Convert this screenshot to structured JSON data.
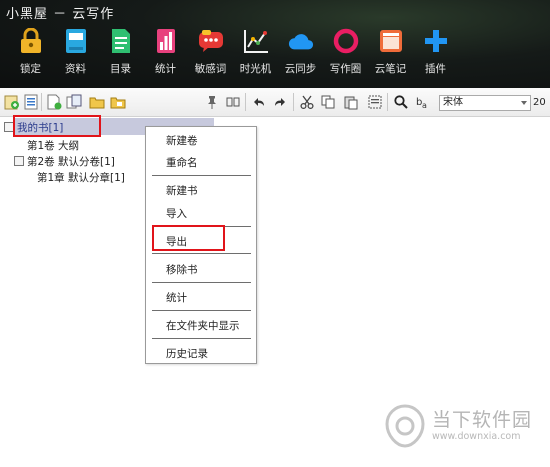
{
  "app": {
    "title": "小黑屋 － 云写作"
  },
  "toolbar": {
    "items": [
      {
        "label": "锁定",
        "icon": "lock-icon",
        "color": "#f0b429"
      },
      {
        "label": "资料",
        "icon": "book-icon",
        "color": "#29a8e0"
      },
      {
        "label": "目录",
        "icon": "document-icon",
        "color": "#2fbf71"
      },
      {
        "label": "统计",
        "icon": "bar-chart-icon",
        "color": "#e8417d"
      },
      {
        "label": "敏感词",
        "icon": "speech-bubble-icon",
        "color": "#e53935"
      },
      {
        "label": "时光机",
        "icon": "line-chart-icon",
        "color": "#f2f2f2"
      },
      {
        "label": "云同步",
        "icon": "cloud-icon",
        "color": "#2196f3"
      },
      {
        "label": "写作圈",
        "icon": "ring-icon",
        "color": "#e91e63"
      },
      {
        "label": "云笔记",
        "icon": "notebook-icon",
        "color": "#ef6c3a"
      },
      {
        "label": "插件",
        "icon": "plus-icon",
        "color": "#2196f3"
      }
    ]
  },
  "format_bar": {
    "font_name": "宋体",
    "font_size": "20"
  },
  "tree": {
    "root": "我的书[1]",
    "nodes": [
      {
        "label": "第1卷 大纲"
      },
      {
        "label": "第2卷 默认分卷[1]"
      },
      {
        "label": "第1章 默认分章[1]"
      }
    ]
  },
  "context_menu": {
    "items": [
      "新建卷",
      "重命名",
      "新建书",
      "导入",
      "导出",
      "移除书",
      "统计",
      "在文件夹中显示",
      "历史记录"
    ]
  },
  "watermark": {
    "name": "当下软件园",
    "url": "www.downxia.com"
  }
}
